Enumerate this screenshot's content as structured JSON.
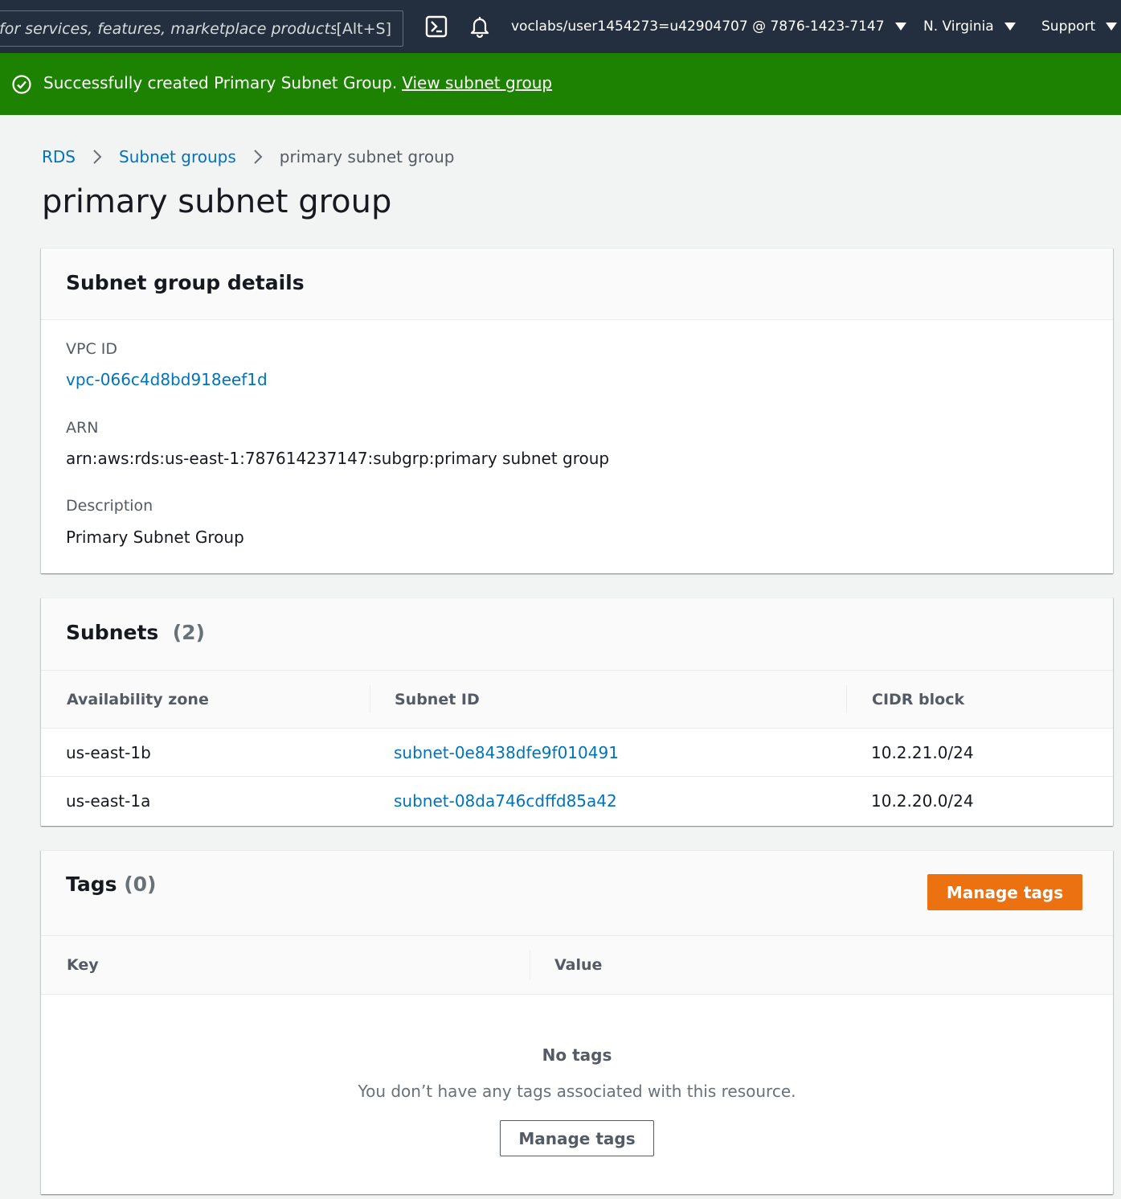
{
  "topnav": {
    "search_placeholder": "for services, features, marketplace products,",
    "search_shortcut": "[Alt+S]",
    "account": "voclabs/user1454273=u42904707 @ 7876-1423-7147",
    "region": "N. Virginia",
    "support": "Support",
    "icons": [
      "cloudshell-icon",
      "bell-icon"
    ]
  },
  "flash": {
    "message": "Successfully created Primary Subnet Group.",
    "link": "View subnet group",
    "color": "#1d8102"
  },
  "breadcrumb": {
    "items": [
      "RDS",
      "Subnet groups"
    ],
    "current": "primary subnet group"
  },
  "page": {
    "title": "primary subnet group"
  },
  "details": {
    "title": "Subnet group details",
    "vpc_label": "VPC ID",
    "vpc_value": "vpc-066c4d8bd918eef1d",
    "arn_label": "ARN",
    "arn_value": "arn:aws:rds:us-east-1:787614237147:subgrp:primary subnet group",
    "desc_label": "Description",
    "desc_value": "Primary Subnet Group"
  },
  "subnets": {
    "title": "Subnets",
    "count": "(2)",
    "columns": [
      "Availability zone",
      "Subnet ID",
      "CIDR block"
    ],
    "rows": [
      {
        "az": "us-east-1b",
        "subnet_id": "subnet-0e8438dfe9f010491",
        "cidr": "10.2.21.0/24"
      },
      {
        "az": "us-east-1a",
        "subnet_id": "subnet-08da746cdffd85a42",
        "cidr": "10.2.20.0/24"
      }
    ]
  },
  "tags": {
    "title": "Tags",
    "count": "(0)",
    "manage_button": "Manage tags",
    "columns": [
      "Key",
      "Value"
    ],
    "empty_title": "No tags",
    "empty_desc": "You don’t have any tags associated with this resource.",
    "empty_button": "Manage tags",
    "accent": "#ec7211"
  }
}
